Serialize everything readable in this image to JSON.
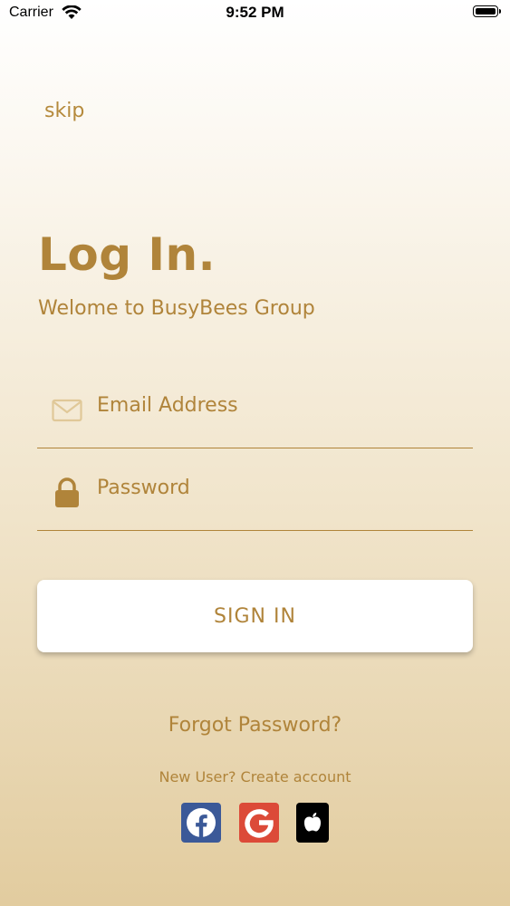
{
  "status_bar": {
    "carrier": "Carrier",
    "time": "9:52 PM"
  },
  "skip_label": "skip",
  "title": "Log In.",
  "subtitle": "Welome to BusyBees Group",
  "email": {
    "placeholder": "Email Address",
    "value": "",
    "icon": "envelope-icon"
  },
  "password": {
    "placeholder": "Password",
    "value": "",
    "icon": "lock-icon"
  },
  "sign_in_label": "SIGN IN",
  "forgot_password_label": "Forgot Password?",
  "new_user_label": "New User? Create account",
  "social": [
    {
      "name": "facebook-icon",
      "color": "#3b5998"
    },
    {
      "name": "google-icon",
      "color": "#dc4a38"
    },
    {
      "name": "apple-icon",
      "color": "#000000"
    }
  ],
  "colors": {
    "accent": "#b0843a"
  }
}
